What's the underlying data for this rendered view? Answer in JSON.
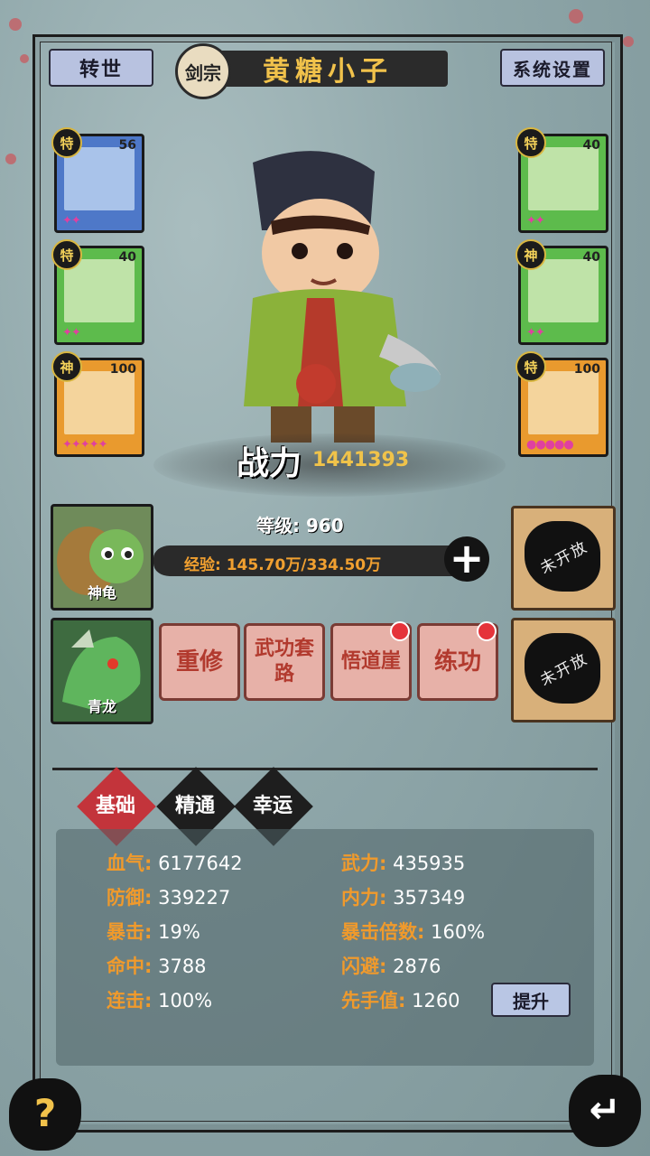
{
  "header": {
    "rebirth_label": "转世",
    "sect": "剑宗",
    "player_name": "黄糖小子",
    "settings_label": "系统设置"
  },
  "equipment_left": [
    {
      "tag": "特",
      "level": "56",
      "rarity": "blue",
      "stars": "✦✦",
      "icon": "sword-icon"
    },
    {
      "tag": "特",
      "level": "40",
      "rarity": "green",
      "stars": "✦✦",
      "icon": "armor-icon"
    },
    {
      "tag": "神",
      "level": "100",
      "rarity": "orange",
      "stars": "✦✦✦✦✦",
      "icon": "ring-icon"
    }
  ],
  "equipment_right": [
    {
      "tag": "特",
      "level": "40",
      "rarity": "green",
      "stars": "✦✦",
      "icon": "hat-icon"
    },
    {
      "tag": "神",
      "level": "40",
      "rarity": "green",
      "stars": "✦✦",
      "icon": "gourd-icon"
    },
    {
      "tag": "特",
      "level": "100",
      "rarity": "orange",
      "stars": "●●●●●",
      "icon": "boots-icon"
    }
  ],
  "combat": {
    "label": "战力",
    "value": "1441393"
  },
  "level_text": "等级: 960",
  "exp_text": "经验: 145.70万/334.50万",
  "pets": [
    {
      "name": "神龟"
    },
    {
      "name": "青龙"
    }
  ],
  "locked_slots": [
    {
      "label": "未开放"
    },
    {
      "label": "未开放"
    }
  ],
  "skills": [
    {
      "label": "重修",
      "dot": false
    },
    {
      "label": "武功套路",
      "dot": false
    },
    {
      "label": "悟道崖",
      "dot": true
    },
    {
      "label": "练功",
      "dot": true
    }
  ],
  "tabs": [
    {
      "label": "基础",
      "active": true
    },
    {
      "label": "精通",
      "active": false
    },
    {
      "label": "幸运",
      "active": false
    }
  ],
  "stats_left": [
    {
      "k": "血气:",
      "v": "6177642"
    },
    {
      "k": "防御:",
      "v": "339227"
    },
    {
      "k": "暴击:",
      "v": "19%"
    },
    {
      "k": "命中:",
      "v": "3788"
    },
    {
      "k": "连击:",
      "v": "100%"
    }
  ],
  "stats_right": [
    {
      "k": "武力:",
      "v": "435935"
    },
    {
      "k": "内力:",
      "v": "357349"
    },
    {
      "k": "暴击倍数:",
      "v": "160%"
    },
    {
      "k": "闪避:",
      "v": "2876"
    },
    {
      "k": "先手值:",
      "v": "1260"
    }
  ],
  "upgrade_label": "提升",
  "help_label": "?",
  "back_label": "↵",
  "colors": {
    "accent": "#f1c24b",
    "tab_active": "#c3343b",
    "stat_key": "#f09a2c"
  }
}
